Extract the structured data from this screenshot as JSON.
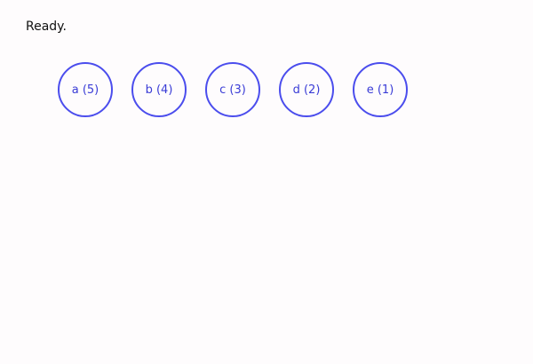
{
  "status": "Ready.",
  "nodes": [
    {
      "label": "a (5)"
    },
    {
      "label": "b (4)"
    },
    {
      "label": "c (3)"
    },
    {
      "label": "d (2)"
    },
    {
      "label": "e (1)"
    }
  ],
  "colors": {
    "node_border": "#4b4ded",
    "node_text": "#3a3cd6",
    "background": "#fefcfd"
  }
}
